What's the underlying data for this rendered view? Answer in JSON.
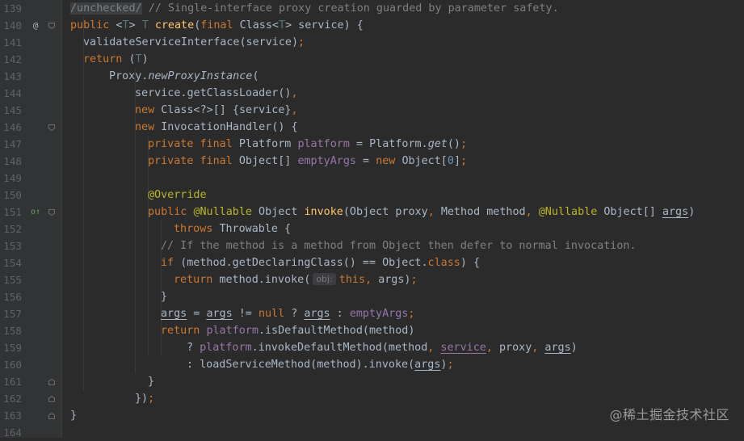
{
  "editor": {
    "lines": [
      {
        "num": "139",
        "parts": [
          {
            "t": "/unchecked/",
            "c": "warnbg"
          },
          {
            "t": " // Single-interface proxy creation guarded by parameter safety.",
            "c": "cm"
          }
        ]
      },
      {
        "num": "140",
        "marker": "@",
        "parts": [
          {
            "t": "public ",
            "c": "kw"
          },
          {
            "t": "<"
          },
          {
            "t": "T",
            "c": "tp"
          },
          {
            "t": "> "
          },
          {
            "t": "T",
            "c": "tp"
          },
          {
            "t": " "
          },
          {
            "t": "create",
            "c": "fn"
          },
          {
            "t": "("
          },
          {
            "t": "final ",
            "c": "kw"
          },
          {
            "t": "Class<"
          },
          {
            "t": "T",
            "c": "tp"
          },
          {
            "t": "> service) {"
          }
        ]
      },
      {
        "num": "141",
        "indent": 1,
        "parts": [
          {
            "t": "validateServiceInterface(service)"
          },
          {
            "t": ";",
            "c": "kw"
          }
        ]
      },
      {
        "num": "142",
        "indent": 1,
        "parts": [
          {
            "t": "return ",
            "c": "kw"
          },
          {
            "t": "("
          },
          {
            "t": "T",
            "c": "tp"
          },
          {
            "t": ")"
          }
        ]
      },
      {
        "num": "143",
        "indent": 3,
        "parts": [
          {
            "t": "Proxy."
          },
          {
            "t": "newProxyInstance",
            "c": "st"
          },
          {
            "t": "("
          }
        ]
      },
      {
        "num": "144",
        "indent": 5,
        "parts": [
          {
            "t": "service.getClassLoader()"
          },
          {
            "t": ",",
            "c": "kw"
          }
        ]
      },
      {
        "num": "145",
        "indent": 5,
        "parts": [
          {
            "t": "new ",
            "c": "kw"
          },
          {
            "t": "Class<?>[] {service}"
          },
          {
            "t": ",",
            "c": "kw"
          }
        ]
      },
      {
        "num": "146",
        "indent": 5,
        "parts": [
          {
            "t": "new ",
            "c": "kw"
          },
          {
            "t": "InvocationHandler() {"
          }
        ]
      },
      {
        "num": "147",
        "indent": 6,
        "parts": [
          {
            "t": "private final ",
            "c": "kw"
          },
          {
            "t": "Platform "
          },
          {
            "t": "platform",
            "c": "fld"
          },
          {
            "t": " = Platform."
          },
          {
            "t": "get",
            "c": "st"
          },
          {
            "t": "()"
          },
          {
            "t": ";",
            "c": "kw"
          }
        ]
      },
      {
        "num": "148",
        "indent": 6,
        "parts": [
          {
            "t": "private final ",
            "c": "kw"
          },
          {
            "t": "Object[] "
          },
          {
            "t": "emptyArgs",
            "c": "fld"
          },
          {
            "t": " = "
          },
          {
            "t": "new ",
            "c": "kw"
          },
          {
            "t": "Object["
          },
          {
            "t": "0",
            "c": "num"
          },
          {
            "t": "]"
          },
          {
            "t": ";",
            "c": "kw"
          }
        ]
      },
      {
        "num": "149",
        "parts": []
      },
      {
        "num": "150",
        "indent": 6,
        "parts": [
          {
            "t": "@Override",
            "c": "ann"
          }
        ]
      },
      {
        "num": "151",
        "marker": "o↑",
        "indent": 6,
        "parts": [
          {
            "t": "public ",
            "c": "kw"
          },
          {
            "t": "@Nullable",
            "c": "ann"
          },
          {
            "t": " Object "
          },
          {
            "t": "invoke",
            "c": "fn"
          },
          {
            "t": "(Object proxy"
          },
          {
            "t": ", ",
            "c": "kw"
          },
          {
            "t": "Method method"
          },
          {
            "t": ", ",
            "c": "kw"
          },
          {
            "t": "@Nullable",
            "c": "ann"
          },
          {
            "t": " Object[] "
          },
          {
            "t": "args",
            "c": "u"
          },
          {
            "t": ")"
          }
        ]
      },
      {
        "num": "152",
        "indent": 8,
        "parts": [
          {
            "t": "throws ",
            "c": "kw"
          },
          {
            "t": "Throwable {"
          }
        ]
      },
      {
        "num": "153",
        "indent": 7,
        "parts": [
          {
            "t": "// If the method is a method from Object then defer to normal invocation.",
            "c": "cm"
          }
        ]
      },
      {
        "num": "154",
        "indent": 7,
        "parts": [
          {
            "t": "if ",
            "c": "kw"
          },
          {
            "t": "(method.getDeclaringClass() == Object."
          },
          {
            "t": "class",
            "c": "kw"
          },
          {
            "t": ") {"
          }
        ]
      },
      {
        "num": "155",
        "indent": 8,
        "parts": [
          {
            "t": "return ",
            "c": "kw"
          },
          {
            "t": "method.invoke("
          },
          {
            "hint": "obj:"
          },
          {
            "t": "this",
            "c": "kw"
          },
          {
            "t": ", ",
            "c": "kw"
          },
          {
            "t": "args)"
          },
          {
            "t": ";",
            "c": "kw"
          }
        ]
      },
      {
        "num": "156",
        "indent": 7,
        "parts": [
          {
            "t": "}"
          }
        ]
      },
      {
        "num": "157",
        "indent": 7,
        "parts": [
          {
            "t": "args",
            "c": "u"
          },
          {
            "t": " = "
          },
          {
            "t": "args",
            "c": "u"
          },
          {
            "t": " != "
          },
          {
            "t": "null ",
            "c": "kw"
          },
          {
            "t": "? "
          },
          {
            "t": "args",
            "c": "u"
          },
          {
            "t": " : "
          },
          {
            "t": "emptyArgs",
            "c": "fld"
          },
          {
            "t": ";",
            "c": "kw"
          }
        ]
      },
      {
        "num": "158",
        "indent": 7,
        "parts": [
          {
            "t": "return ",
            "c": "kw"
          },
          {
            "t": "platform",
            "c": "fld"
          },
          {
            "t": ".isDefaultMethod(method)"
          }
        ]
      },
      {
        "num": "159",
        "indent": 9,
        "parts": [
          {
            "t": "? "
          },
          {
            "t": "platform",
            "c": "fld"
          },
          {
            "t": ".invokeDefaultMethod(method"
          },
          {
            "t": ", ",
            "c": "kw"
          },
          {
            "t": "service",
            "c": "fld u"
          },
          {
            "t": ", ",
            "c": "kw"
          },
          {
            "t": "proxy"
          },
          {
            "t": ", ",
            "c": "kw"
          },
          {
            "t": "args",
            "c": "u"
          },
          {
            "t": ")"
          }
        ]
      },
      {
        "num": "160",
        "indent": 9,
        "parts": [
          {
            "t": ": loadServiceMethod(method).invoke("
          },
          {
            "t": "args",
            "c": "u"
          },
          {
            "t": ")"
          },
          {
            "t": ";",
            "c": "kw"
          }
        ]
      },
      {
        "num": "161",
        "indent": 6,
        "parts": [
          {
            "t": "}"
          }
        ]
      },
      {
        "num": "162",
        "indent": 5,
        "parts": [
          {
            "t": "})"
          },
          {
            "t": ";",
            "c": "kw"
          }
        ]
      },
      {
        "num": "163",
        "parts": [
          {
            "t": "}"
          }
        ]
      },
      {
        "num": "164",
        "parts": []
      }
    ]
  },
  "watermark": "@稀土掘金技术社区",
  "colors": {
    "background": "#2b2b2b",
    "keyword": "#cc7832",
    "method": "#ffc66d",
    "annotation": "#bbb529",
    "comment": "#808080",
    "field": "#9876aa",
    "number": "#6897bb",
    "type_param": "#507874"
  }
}
